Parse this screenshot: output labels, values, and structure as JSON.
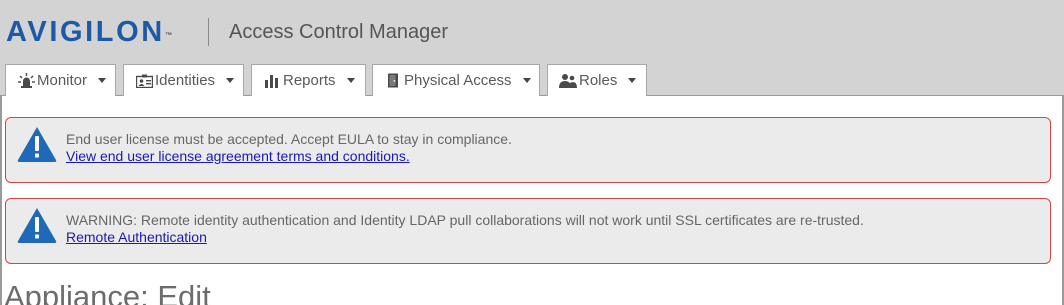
{
  "header": {
    "logo": "AVIGILON",
    "logo_tm": "™",
    "app_title": "Access Control Manager"
  },
  "nav": {
    "tabs": [
      {
        "label": "Monitor",
        "icon": "alarm-light-icon"
      },
      {
        "label": "Identities",
        "icon": "id-card-icon"
      },
      {
        "label": "Reports",
        "icon": "bar-chart-icon"
      },
      {
        "label": "Physical Access",
        "icon": "door-icon"
      },
      {
        "label": "Roles",
        "icon": "users-icon"
      }
    ]
  },
  "alerts": [
    {
      "icon": "warning-triangle-icon",
      "message": "End user license must be accepted. Accept EULA to stay in compliance.",
      "link": "View end user license agreement terms and conditions."
    },
    {
      "icon": "warning-triangle-icon",
      "message": "WARNING: Remote identity authentication and Identity LDAP pull collaborations will not work until SSL certificates are re-trusted.",
      "link": "Remote Authentication"
    }
  ],
  "page": {
    "title": "Appliance: Edit"
  },
  "colors": {
    "brand": "#1a5aa6",
    "header_bg": "#d4d3d3",
    "alert_border": "#c9494b",
    "alert_icon": "#1f69b8",
    "link": "#1919b3"
  }
}
